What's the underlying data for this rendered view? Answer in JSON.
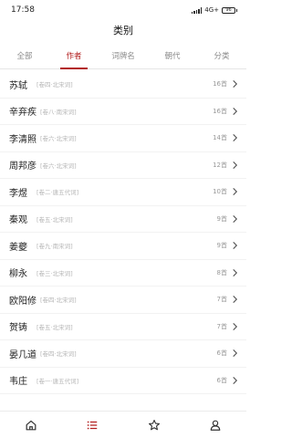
{
  "status": {
    "time": "17:58",
    "network": "4G+",
    "battery": "96"
  },
  "header": {
    "title": "类别"
  },
  "tabs": [
    {
      "label": "全部",
      "active": false
    },
    {
      "label": "作者",
      "active": true
    },
    {
      "label": "词牌名",
      "active": false
    },
    {
      "label": "朝代",
      "active": false
    },
    {
      "label": "分类",
      "active": false
    }
  ],
  "authors": [
    {
      "name": "苏轼",
      "book": "[卷四·北宋词]",
      "count": "16首"
    },
    {
      "name": "辛弃疾",
      "book": "[卷八·南宋词]",
      "count": "16首"
    },
    {
      "name": "李清照",
      "book": "[卷六·北宋词]",
      "count": "14首"
    },
    {
      "name": "周邦彦",
      "book": "[卷六·北宋词]",
      "count": "12首"
    },
    {
      "name": "李煜",
      "book": "[卷二·唐五代词]",
      "count": "10首"
    },
    {
      "name": "秦观",
      "book": "[卷五·北宋词]",
      "count": "9首"
    },
    {
      "name": "姜夔",
      "book": "[卷九·南宋词]",
      "count": "9首"
    },
    {
      "name": "柳永",
      "book": "[卷三·北宋词]",
      "count": "8首"
    },
    {
      "name": "欧阳修",
      "book": "[卷四·北宋词]",
      "count": "7首"
    },
    {
      "name": "贺铸",
      "book": "[卷五·北宋词]",
      "count": "7首"
    },
    {
      "name": "晏几道",
      "book": "[卷四·北宋词]",
      "count": "6首"
    },
    {
      "name": "韦庄",
      "book": "[卷一·唐五代词]",
      "count": "6首"
    }
  ],
  "bottom_nav": [
    {
      "icon": "home-icon",
      "active": false
    },
    {
      "icon": "list-icon",
      "active": true
    },
    {
      "icon": "star-icon",
      "active": false
    },
    {
      "icon": "user-icon",
      "active": false
    }
  ],
  "colors": {
    "accent": "#b21e1e",
    "muted": "#8a8a8a"
  }
}
